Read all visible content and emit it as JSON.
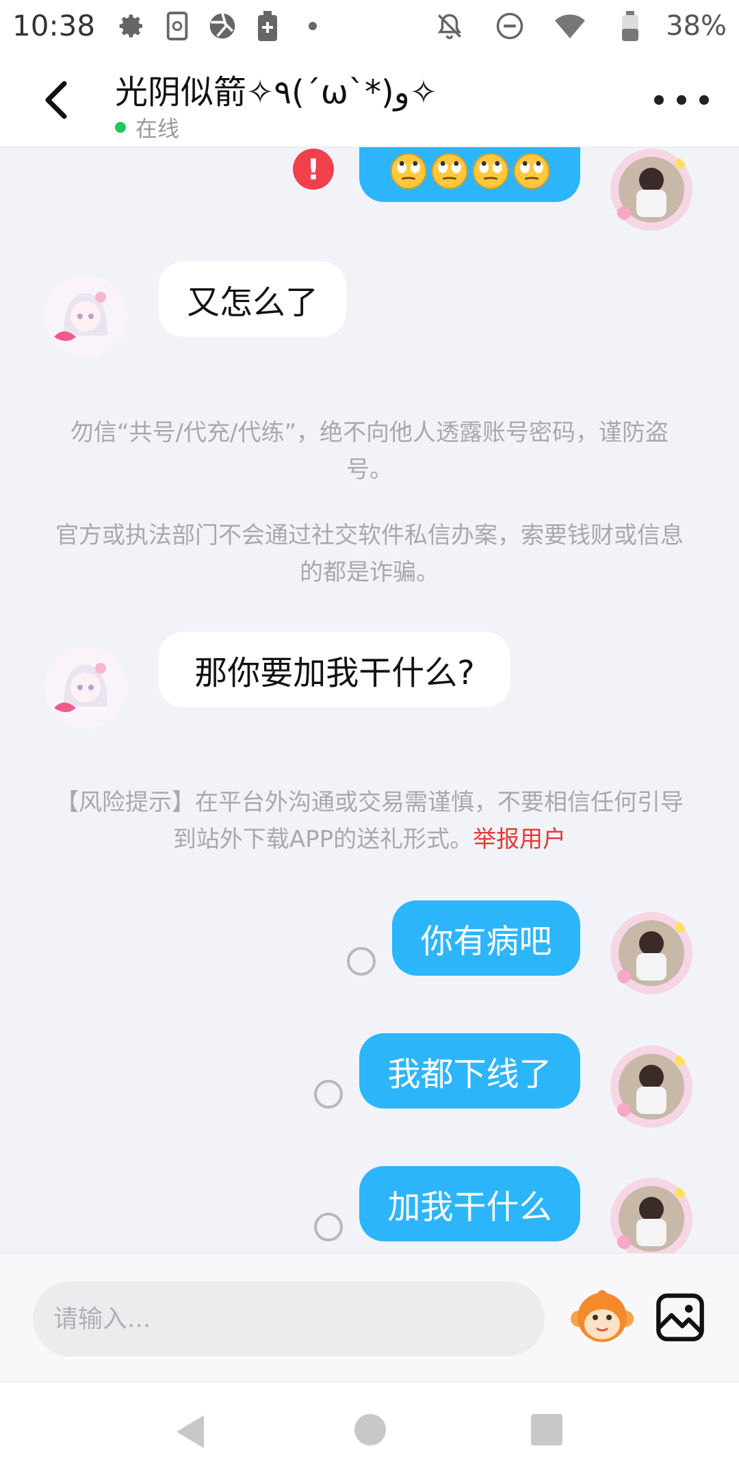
{
  "status_bar": {
    "time": "10:38",
    "battery": "38%",
    "icons": [
      "gear-icon",
      "sim-card-icon",
      "aperture-icon",
      "battery-saver-icon",
      "notification-dot-icon",
      "notifications-off-icon",
      "do-not-disturb-icon",
      "wifi-icon",
      "battery-icon"
    ]
  },
  "header": {
    "title": "光阴似箭✧٩(ˊωˋ*)و✧",
    "presence": "在线",
    "presence_color": "#22c55e"
  },
  "messages": {
    "m1_emoji": "🙄🙄🙄🙄",
    "m2": "又怎么了",
    "notice1": "勿信“共号/代充/代练”，绝不向他人透露账号密码，谨防盗号。",
    "notice2": "官方或执法部门不会通过社交软件私信办案，索要钱财或信息的都是诈骗。",
    "m3": "那你要加我干什么?",
    "risk_notice": "【风险提示】在平台外沟通或交易需谨慎，不要相信任何引导到站外下载APP的送礼形式。",
    "report_link": "举报用户",
    "m4": "你有病吧",
    "m5": "我都下线了",
    "m6": "加我干什么"
  },
  "input": {
    "placeholder": "请输入..."
  },
  "colors": {
    "outgoing_bubble": "#2db5fb",
    "incoming_bubble": "#ffffff",
    "report_link": "#e53935",
    "error_badge": "#f0404c",
    "background": "#f2f3f8"
  }
}
